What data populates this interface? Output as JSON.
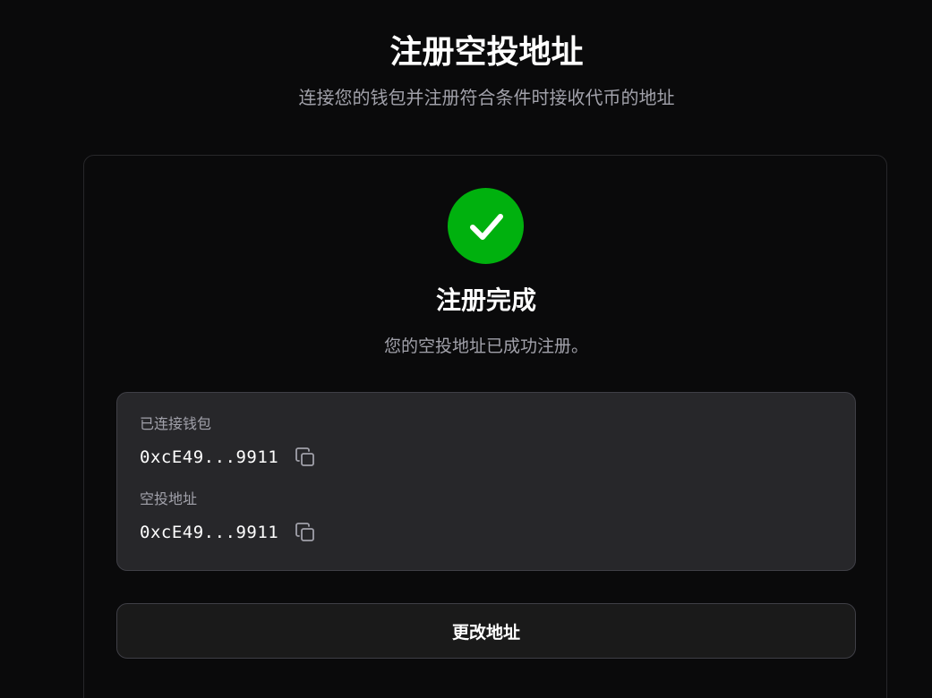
{
  "header": {
    "title": "注册空投地址",
    "subtitle": "连接您的钱包并注册符合条件时接收代币的地址"
  },
  "status": {
    "icon": "check-circle-icon",
    "color": "#00b10e",
    "title": "注册完成",
    "message": "您的空投地址已成功注册。"
  },
  "wallet": {
    "connected_label": "已连接钱包",
    "connected_address": "0xcE49...9911",
    "airdrop_label": "空投地址",
    "airdrop_address": "0xcE49...9911",
    "copy_icon": "copy-icon"
  },
  "actions": {
    "change_address_label": "更改地址"
  }
}
